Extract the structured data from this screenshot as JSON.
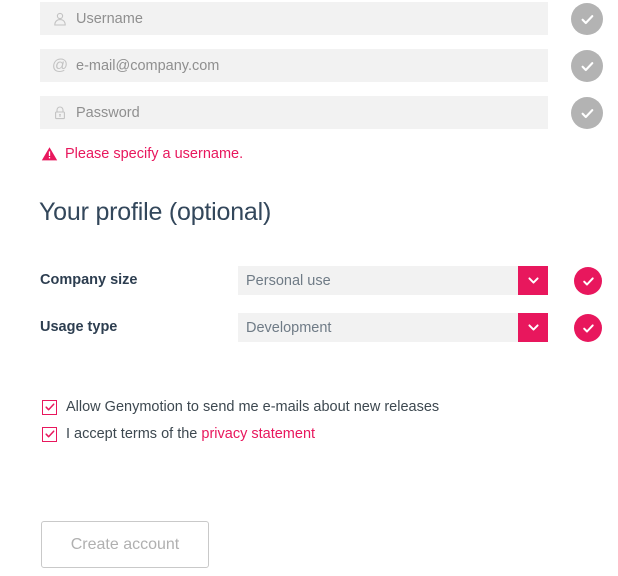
{
  "form": {
    "fields": [
      {
        "name": "username",
        "placeholder": "Username",
        "icon": "user-icon",
        "status": "neutral"
      },
      {
        "name": "email",
        "placeholder": "e-mail@company.com",
        "icon": "at-icon",
        "status": "neutral"
      },
      {
        "name": "password",
        "placeholder": "Password",
        "icon": "lock-icon",
        "status": "neutral"
      }
    ],
    "error": {
      "icon": "warning-triangle-icon",
      "message": "Please specify a username."
    }
  },
  "profile": {
    "heading": "Your profile (optional)",
    "selects": [
      {
        "label": "Company size",
        "value": "Personal use",
        "status": "valid"
      },
      {
        "label": "Usage type",
        "value": "Development",
        "status": "valid"
      }
    ]
  },
  "consents": [
    {
      "checked": true,
      "label": "Allow Genymotion to send me e-mails about new releases"
    },
    {
      "checked": true,
      "label_prefix": "I accept terms of the ",
      "link_text": "privacy statement"
    }
  ],
  "actions": {
    "create_account_label": "Create account",
    "create_account_disabled": true
  },
  "colors": {
    "accent": "#e8175d",
    "neutral_status": "#b3b3b3",
    "field_bg": "#f2f2f2",
    "label_text": "#2d3e50",
    "placeholder_text": "#8f8f8f",
    "heading_text": "#33475b",
    "disabled_text": "#b0b0b0",
    "page_bg": "#ffffff"
  }
}
